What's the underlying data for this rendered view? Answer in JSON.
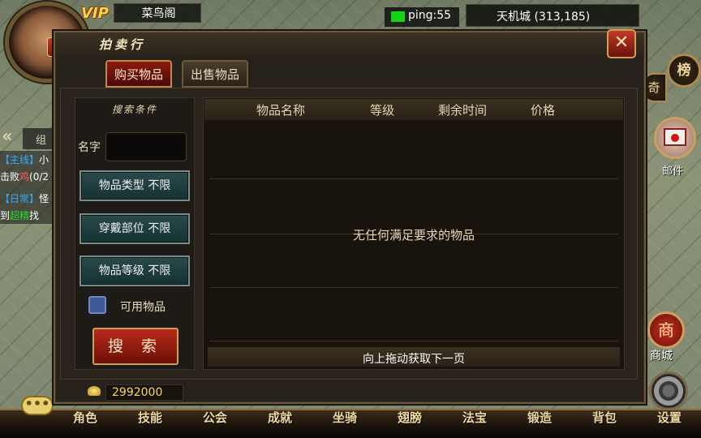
{
  "hud": {
    "vip_label": "VIP",
    "avatar_badge": "",
    "player_name": "菜鸟阁",
    "ping": "ping:55",
    "location": "天机城 (313,185)",
    "rank_button": "榜",
    "qi_button": "奇",
    "mail_label": "邮件",
    "shop_button": "商",
    "shop_label": "商城",
    "settings_label": "设置",
    "chat_button": "•••",
    "quest_arrow": "«",
    "quest_tab": "组",
    "quest_lines": [
      {
        "tag": "【主线】",
        "text": "小"
      },
      {
        "pre": "击败",
        "highlight": "鸡",
        "post": "(0/2"
      },
      {
        "tag": "【日常】",
        "text": "怪"
      },
      {
        "pre": "到",
        "highlight": "超精",
        "post": "找"
      }
    ]
  },
  "bottom_menu": [
    "角色",
    "技能",
    "公会",
    "成就",
    "坐骑",
    "翅膀",
    "法宝",
    "锻造",
    "背包",
    "设置"
  ],
  "dialog": {
    "title": "拍卖行",
    "close_label": "✕",
    "tabs": {
      "buy": "购买物品",
      "sell": "出售物品"
    },
    "filter_heading": "搜索条件",
    "name_label": "名字",
    "name_value": "",
    "filters": {
      "item_type": "物品类型 不限",
      "equip_slot": "穿戴部位 不限",
      "item_level": "物品等级 不限"
    },
    "usable_label": "可用物品",
    "search_label": "搜 索",
    "columns": [
      "物品名称",
      "等级",
      "剩余时间",
      "价格"
    ],
    "empty_message": "无任何满足要求的物品",
    "pagination_hint": "向上拖动获取下一页",
    "gold_amount": "2992000"
  },
  "colors": {
    "gold": "#ffd84a",
    "ping_ok": "#14d414",
    "tab_active": "#8a1a10",
    "filter_button": "#2a4a4a"
  }
}
